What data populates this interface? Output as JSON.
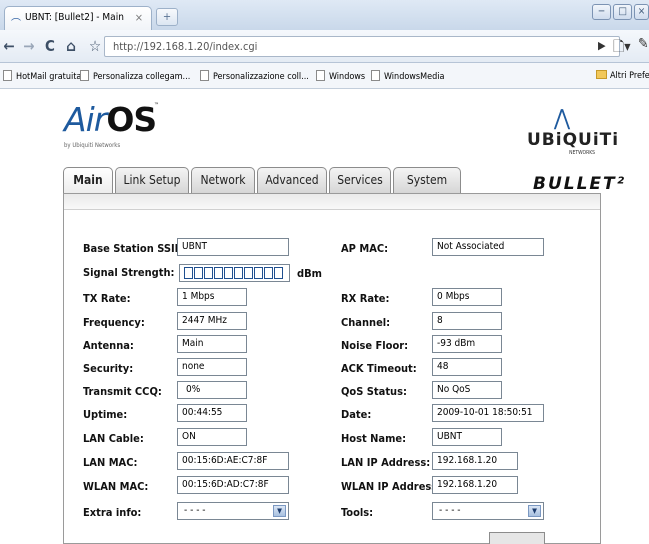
{
  "browser": {
    "tab_title": "UBNT: [Bullet2] - Main",
    "tab_close": "×",
    "new_tab": "+",
    "window_buttons": [
      "−",
      "□",
      "×"
    ],
    "url": "http://192.168.1.20/index.cgi",
    "bookmarks": [
      "HotMail gratuita",
      "Personalizza collegam...",
      "Personalizzazione coll...",
      "Windows",
      "WindowsMedia"
    ],
    "other_bookmarks": "Altri Prefe"
  },
  "branding": {
    "airos_air": "Air",
    "airos_os": "OS",
    "airos_tm": "™",
    "airos_sub": "by Ubiquiti Networks",
    "ubnt_name": "UBiQUiTi",
    "ubnt_sub": "NETWORKS",
    "product": "BULLET²"
  },
  "tabs": [
    "Main",
    "Link Setup",
    "Network",
    "Advanced",
    "Services",
    "System"
  ],
  "active_tab": "Main",
  "status": {
    "base_station_ssid_label": "Base Station SSID:",
    "base_station_ssid": "UBNT",
    "ap_mac_label": "AP MAC:",
    "ap_mac": "Not Associated",
    "signal_strength_label": "Signal Strength:",
    "signal_unit": "dBm",
    "signal_bars_filled": 0,
    "tx_rate_label": "TX Rate:",
    "tx_rate": "1 Mbps",
    "rx_rate_label": "RX Rate:",
    "rx_rate": "0 Mbps",
    "frequency_label": "Frequency:",
    "frequency": "2447 MHz",
    "channel_label": "Channel:",
    "channel": "8",
    "antenna_label": "Antenna:",
    "antenna": "Main",
    "noise_floor_label": "Noise Floor:",
    "noise_floor": "-93 dBm",
    "security_label": "Security:",
    "security": "none",
    "ack_timeout_label": "ACK Timeout:",
    "ack_timeout": "48",
    "transmit_ccq_label": "Transmit CCQ:",
    "transmit_ccq": "0%",
    "qos_status_label": "QoS Status:",
    "qos_status": "No QoS",
    "uptime_label": "Uptime:",
    "uptime": "00:44:55",
    "date_label": "Date:",
    "date": "2009-10-01 18:50:51",
    "lan_cable_label": "LAN Cable:",
    "lan_cable": "ON",
    "host_name_label": "Host Name:",
    "host_name": "UBNT",
    "lan_mac_label": "LAN MAC:",
    "lan_mac": "00:15:6D:AE:C7:8F",
    "lan_ip_label": "LAN IP Address:",
    "lan_ip": "192.168.1.20",
    "wlan_mac_label": "WLAN MAC:",
    "wlan_mac": "00:15:6D:AD:C7:8F",
    "wlan_ip_label": "WLAN IP Address:",
    "wlan_ip": "192.168.1.20",
    "extra_info_label": "Extra info:",
    "extra_info_value": "- - - -",
    "tools_label": "Tools:",
    "tools_value": "- - - -"
  },
  "colors": {
    "brand_blue": "#1e5a9e",
    "signal_bar_border": "#1f4f8f"
  }
}
